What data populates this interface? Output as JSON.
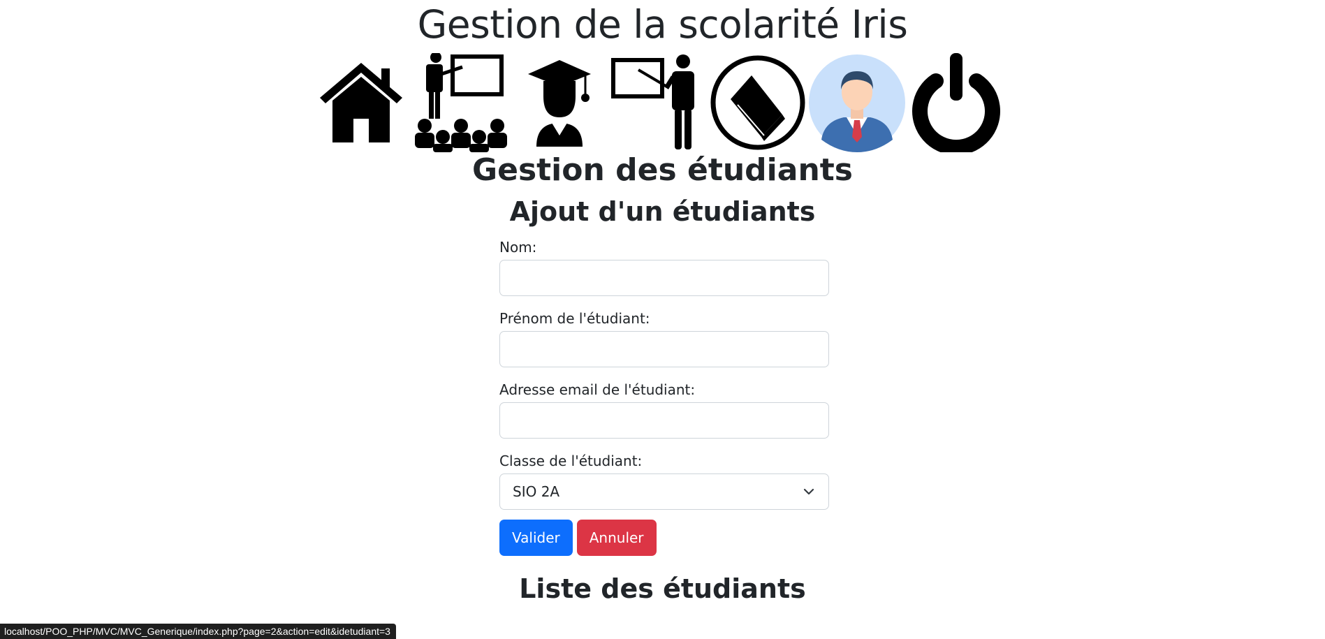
{
  "header": {
    "title": "Gestion de la scolarité Iris"
  },
  "nav_icons": [
    "home-icon",
    "teacher-class-icon",
    "graduate-student-icon",
    "teacher-board-icon",
    "book-icon",
    "user-avatar-icon",
    "power-icon"
  ],
  "section": {
    "title": "Gestion des étudiants"
  },
  "form": {
    "title": "Ajout d'un étudiants",
    "nom_label": "Nom:",
    "nom_value": "",
    "prenom_label": "Prénom de l'étudiant:",
    "prenom_value": "",
    "email_label": "Adresse email de l'étudiant:",
    "email_value": "",
    "classe_label": "Classe de l'étudiant:",
    "classe_selected": "SIO 2A",
    "submit_label": "Valider",
    "cancel_label": "Annuler"
  },
  "list": {
    "title": "Liste des étudiants"
  },
  "status_bar": {
    "url": "localhost/POO_PHP/MVC/MVC_Generique/index.php?page=2&action=edit&idetudiant=3"
  },
  "colors": {
    "primary": "#0d6efd",
    "danger": "#dc3545",
    "text": "#212529"
  }
}
